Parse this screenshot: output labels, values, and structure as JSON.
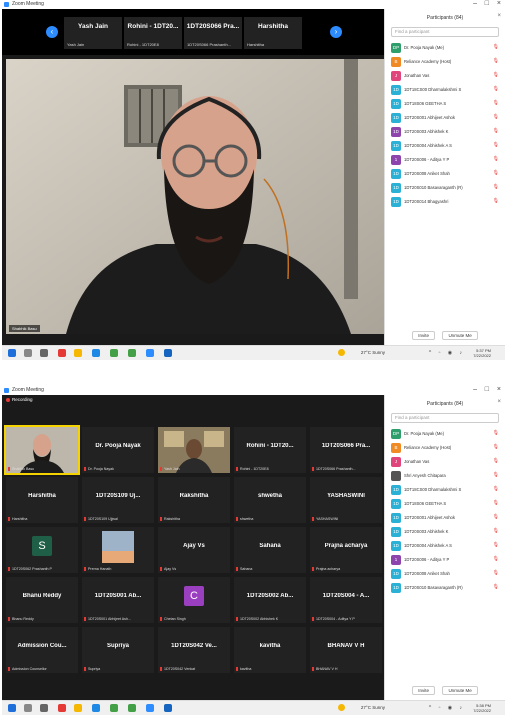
{
  "screenshot1": {
    "window_title": "Zoom Meeting",
    "top_strip": [
      {
        "name": "Yash Jain",
        "label": "Yash Jain"
      },
      {
        "name": "Rohini - 1DT20...",
        "label": "Rohini - 1DT20E8"
      },
      {
        "name": "1DT20S066 Pra...",
        "label": "1DT20S066 Prashanth..."
      },
      {
        "name": "Harshitha",
        "label": "Harshitha"
      }
    ],
    "active_speaker_label": "Shabhik Basu",
    "participants_panel": {
      "title": "Participants (84)",
      "search_placeholder": "Find a participant",
      "items": [
        {
          "initials": "DP",
          "name": "Dr. Pooja Nayak (Me)",
          "color": "#2e9e6b"
        },
        {
          "initials": "B",
          "name": "Reliance Academy (Host)",
          "color": "#f08a24"
        },
        {
          "initials": "J",
          "name": "Jonathan Vas",
          "color": "#e0457b"
        },
        {
          "initials": "1D",
          "name": "1DT18CS00 Dharmalakshmi S",
          "color": "#2bb0d6"
        },
        {
          "initials": "1D",
          "name": "1DT18S06 GEETHA S",
          "color": "#2bb0d6"
        },
        {
          "initials": "1D",
          "name": "1DT20S001 Abhijeet Ashok",
          "color": "#2bb0d6"
        },
        {
          "initials": "1D",
          "name": "1DT20S003 Abhishek K",
          "color": "#8e44ad"
        },
        {
          "initials": "1D",
          "name": "1DT20S004 Abhishek A S",
          "color": "#2bb0d6"
        },
        {
          "initials": "1",
          "name": "1DT20S006 - Aditya Y P",
          "color": "#8e44ad"
        },
        {
          "initials": "1D",
          "name": "1DT20S008 Aniket Shah",
          "color": "#2bb0d6"
        },
        {
          "initials": "1D",
          "name": "1DT20S010 Basavaraganth (R)",
          "color": "#2bb0d6"
        },
        {
          "initials": "1D",
          "name": "1DT20S014 Bhagyashri",
          "color": "#2bb0d6"
        }
      ],
      "buttons": [
        "Invite",
        "Unmute Me"
      ]
    },
    "taskbar": {
      "weather": "27°C Sunny",
      "time": "5:37 PM",
      "date": "7/22/2022"
    }
  },
  "screenshot2": {
    "window_title": "Zoom Meeting",
    "recording_label": "Recording",
    "grid": [
      {
        "name": "",
        "label": "Shabhik Basu",
        "video": "bald"
      },
      {
        "name": "Dr. Pooja Nayak",
        "label": "Dr. Pooja Nayak"
      },
      {
        "name": "",
        "label": "Yash Jain",
        "video": "room"
      },
      {
        "name": "Rohini - 1DT20...",
        "label": "Rohini - 1DT20E8"
      },
      {
        "name": "1DT20S066 Pra...",
        "label": "1DT20S066 Prashanth..."
      },
      {
        "name": "Harshitha",
        "label": "Harshitha"
      },
      {
        "name": "1DT20S109 Uj...",
        "label": "1DT20S109 Ujjwal"
      },
      {
        "name": "Rakshitha",
        "label": "Rakshitha"
      },
      {
        "name": "shwetha",
        "label": "shwetha"
      },
      {
        "name": "YASHASWINI",
        "label": "YASHASWINI"
      },
      {
        "name": "",
        "label": "1DT20S062 Prashanth P",
        "avatar": "S",
        "avatar_color": "#1f5e47"
      },
      {
        "name": "",
        "label": "Prerna Hanath",
        "video": "landscape"
      },
      {
        "name": "Ajay Vs",
        "label": "Ajay Vs"
      },
      {
        "name": "Sahana",
        "label": "Sahana"
      },
      {
        "name": "Prajna acharya",
        "label": "Prajna acharya"
      },
      {
        "name": "Bhanu Reddy",
        "label": "Bhanu Reddy"
      },
      {
        "name": "1DT20S001 Ab...",
        "label": "1DT20S001 Abhijeet Ash..."
      },
      {
        "name": "",
        "label": "Chetan Singh",
        "avatar": "C",
        "avatar_color": "#9b3fc1"
      },
      {
        "name": "1DT20S002 Ab...",
        "label": "1DT20S002 Abhishek K"
      },
      {
        "name": "1DT20S004 - A...",
        "label": "1DT20S004 - Aditya Y P"
      },
      {
        "name": "Admission Cou...",
        "label": "Admission Counsellor"
      },
      {
        "name": "Supriya",
        "label": "Supriya"
      },
      {
        "name": "1DT20S042 Ve...",
        "label": "1DT20S042 Venkat"
      },
      {
        "name": "kavitha",
        "label": "kavitha"
      },
      {
        "name": "BHANAV V H",
        "label": "BHANAV V H"
      }
    ],
    "participants_panel": {
      "title": "Participants (84)",
      "search_placeholder": "Find a participant",
      "items": [
        {
          "initials": "DP",
          "name": "Dr. Pooja Nayak (Me)",
          "color": "#2e9e6b"
        },
        {
          "initials": "B",
          "name": "Reliance Academy (Host)",
          "color": "#f08a24"
        },
        {
          "initials": "J",
          "name": "Jonathan Vas",
          "color": "#e0457b"
        },
        {
          "initials": "",
          "name": "Shri Anyesh Chitapara",
          "color": "#555555"
        },
        {
          "initials": "1D",
          "name": "1DT18CS00 Dharmalakshmi S",
          "color": "#2bb0d6"
        },
        {
          "initials": "1D",
          "name": "1DT18S06 GEETHA S",
          "color": "#2bb0d6"
        },
        {
          "initials": "1D",
          "name": "1DT20S001 Abhijeet Ashok",
          "color": "#2bb0d6"
        },
        {
          "initials": "1D",
          "name": "1DT20S003 Abhishek K",
          "color": "#2bb0d6"
        },
        {
          "initials": "1D",
          "name": "1DT20S004 Abhishek A S",
          "color": "#2bb0d6"
        },
        {
          "initials": "1",
          "name": "1DT20S006 - Aditya Y P",
          "color": "#8e44ad"
        },
        {
          "initials": "1D",
          "name": "1DT20S008 Aniket Shah",
          "color": "#2bb0d6"
        },
        {
          "initials": "1D",
          "name": "1DT20S010 Basavaraganth (R)",
          "color": "#2bb0d6"
        }
      ],
      "buttons": [
        "Invite",
        "Unmute Me"
      ]
    },
    "taskbar": {
      "weather": "27°C Sunny",
      "time": "5:38 PM",
      "date": "7/22/2022"
    }
  }
}
